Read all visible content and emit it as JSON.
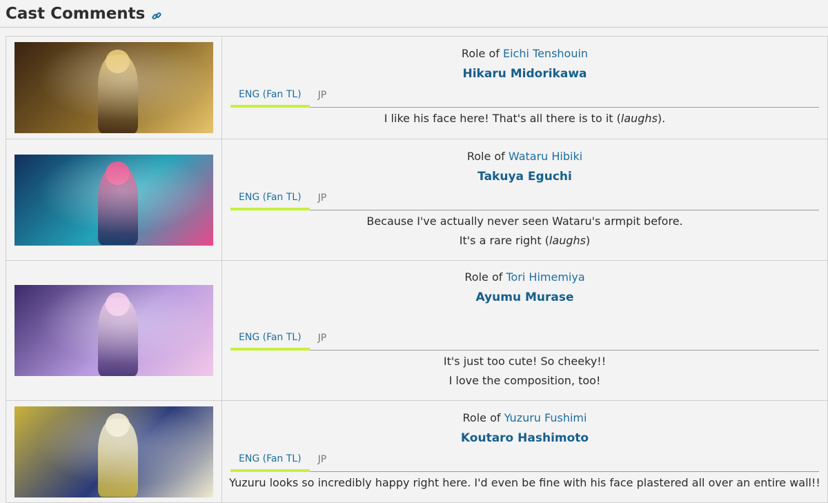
{
  "section": {
    "title": "Cast Comments",
    "link_icon": "link-icon"
  },
  "tab_labels": {
    "eng": "ENG (Fan TL)",
    "jp": "JP"
  },
  "role_prefix": "Role of",
  "entries": [
    {
      "character": "Eichi Tenshouin",
      "actor": "Hikaru Midorikawa",
      "comment_lines": [
        "I like his face here! That's all there is to it (laughs)."
      ],
      "art_colors": [
        "#3a2412",
        "#8a6a2a",
        "#e6c46a"
      ]
    },
    {
      "character": "Wataru Hibiki",
      "actor": "Takuya Eguchi",
      "comment_lines": [
        "Because I've actually never seen Wataru's armpit before.",
        "It's a rare right (laughs)"
      ],
      "art_colors": [
        "#11305c",
        "#23a2b8",
        "#e84a8a"
      ]
    },
    {
      "character": "Tori Himemiya",
      "actor": "Ayumu Murase",
      "comment_lines": [
        "It's just too cute! So cheeky!!",
        "I love the composition, too!"
      ],
      "art_colors": [
        "#3a2a6a",
        "#b79adf",
        "#f2c7e8"
      ]
    },
    {
      "character": "Yuzuru Fushimi",
      "actor": "Koutaro Hashimoto",
      "comment_lines": [
        "Yuzuru looks so incredibly happy right here. I'd even be fine with his face plastered all over an entire wall!!"
      ],
      "art_colors": [
        "#c9b23a",
        "#2a3a7a",
        "#f0ead0"
      ]
    }
  ]
}
